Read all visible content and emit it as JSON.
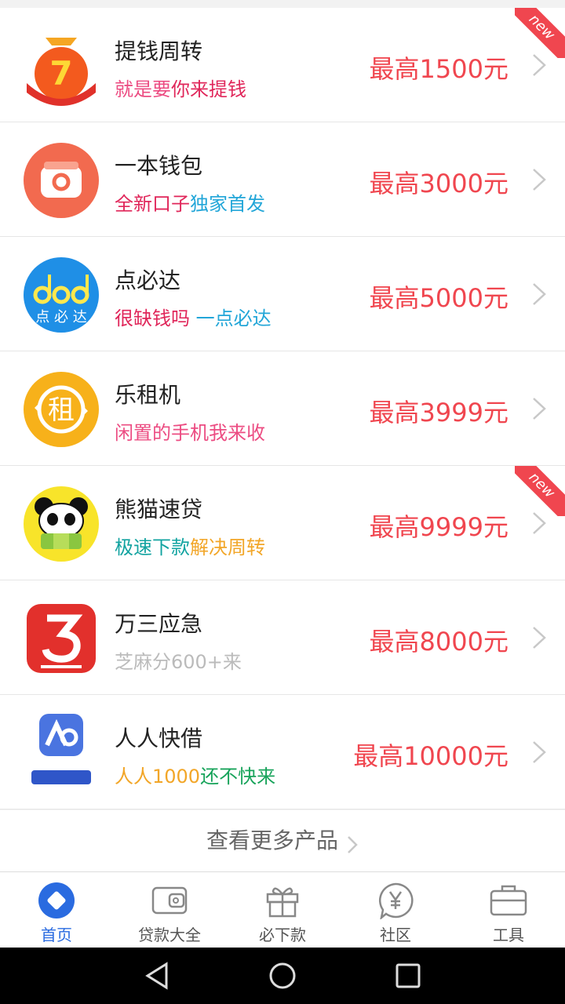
{
  "products": [
    {
      "name": "提钱周转",
      "slogan": [
        {
          "text": "就是要",
          "color": "#ec4c82"
        },
        {
          "text": "你来提钱",
          "color": "#e0265a"
        }
      ],
      "amount": "最高1500元",
      "new_label": "new"
    },
    {
      "name": "一本钱包",
      "slogan": [
        {
          "text": "全新口子",
          "color": "#e0265a"
        },
        {
          "text": "独家首发",
          "color": "#22a6d8"
        }
      ],
      "amount": "最高3000元"
    },
    {
      "name": "点必达",
      "slogan": [
        {
          "text": "很缺钱吗 ",
          "color": "#e0265a"
        },
        {
          "text": "一点必达",
          "color": "#22a6d8"
        }
      ],
      "amount": "最高5000元",
      "logo_text": "点 必 达"
    },
    {
      "name": "乐租机",
      "slogan": [
        {
          "text": "闲置的手机我来收",
          "color": "#ec4c82"
        }
      ],
      "amount": "最高3999元",
      "logo_text": "租"
    },
    {
      "name": "熊猫速贷",
      "slogan": [
        {
          "text": "极速下款",
          "color": "#12a3a0"
        },
        {
          "text": "解决周转",
          "color": "#f2a628"
        }
      ],
      "amount": "最高9999元",
      "new_label": "new"
    },
    {
      "name": "万三应急",
      "slogan": [
        {
          "text": "芝麻分600+来",
          "color": "#bbbbbb"
        }
      ],
      "amount": "最高8000元"
    },
    {
      "name": "人人快借",
      "slogan": [
        {
          "text": "人人1000",
          "color": "#f2a628"
        },
        {
          "text": "还不快来",
          "color": "#17a35a"
        }
      ],
      "amount": "最高10000元"
    }
  ],
  "more_label": "查看更多产品",
  "tabs": [
    {
      "label": "首页",
      "icon": "home-diamond-icon",
      "active": true
    },
    {
      "label": "贷款大全",
      "icon": "wallet-icon",
      "active": false
    },
    {
      "label": "必下款",
      "icon": "gift-icon",
      "active": false
    },
    {
      "label": "社区",
      "icon": "yen-chat-icon",
      "active": false
    },
    {
      "label": "工具",
      "icon": "toolbox-icon",
      "active": false
    }
  ],
  "colors": {
    "accent": "#f0464f",
    "tab_active": "#2a6be0"
  }
}
